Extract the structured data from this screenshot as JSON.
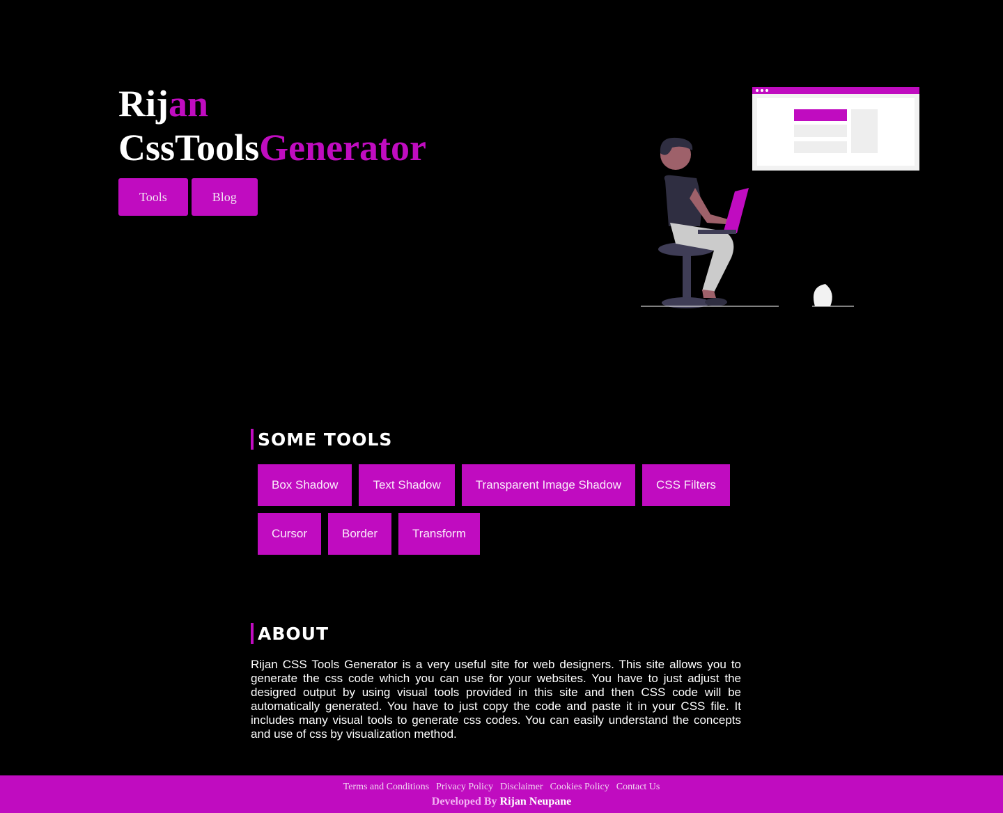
{
  "hero": {
    "title_line1_white": "Rij",
    "title_line1_accent": "an",
    "title_line2_white": "CssTools",
    "title_line2_accent": "Generator",
    "nav": [
      "Tools",
      "Blog"
    ]
  },
  "tools_section": {
    "heading": "SOME TOOLS",
    "items": [
      "Box Shadow",
      "Text Shadow",
      "Transparent Image Shadow",
      "CSS Filters",
      "Cursor",
      "Border",
      "Transform"
    ]
  },
  "about_section": {
    "heading": "ABOUT",
    "text": "Rijan CSS Tools Generator is a very useful site for web designers. This site allows you to generate the css code which you can use for your websites. You have to just adjust the desigred output by using visual tools provided in this site and then CSS code will be automatically generated. You have to just copy the code and paste it in your CSS file. It includes many visual tools to generate css codes. You can easily understand the concepts and use of css by visualization method."
  },
  "footer": {
    "links": [
      "Terms and Conditions",
      "Privacy Policy",
      "Disclaimer",
      "Cookies Policy",
      "Contact Us"
    ],
    "credit_prefix": "Developed By",
    "credit_name": "Rijan Neupane"
  },
  "colors": {
    "accent": "#c00cc0",
    "background": "#000000"
  }
}
